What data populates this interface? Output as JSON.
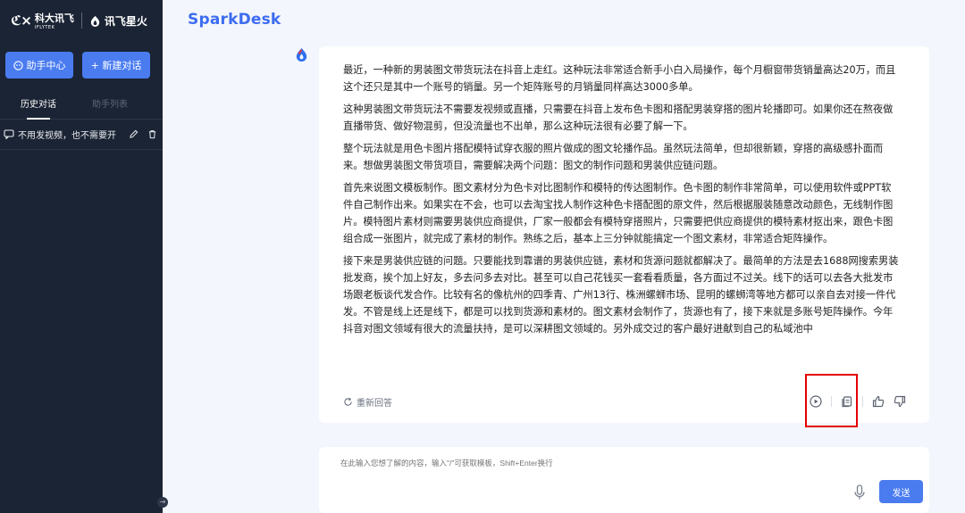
{
  "sidebar": {
    "logo_iflytek": "科大讯飞",
    "logo_iflytek_sub": "IFLYTEK",
    "logo_spark": "讯飞星火",
    "help_button": "助手中心",
    "new_chat_button": "+ 新建对话",
    "tabs": [
      "历史对话",
      "助手列表"
    ],
    "conversations": [
      {
        "title": "不用发视频，也不需要开"
      }
    ]
  },
  "header": {
    "brand": "SparkDesk"
  },
  "message": {
    "paragraphs": [
      "最近，一种新的男装图文带货玩法在抖音上走红。这种玩法非常适合新手小白入局操作，每个月橱窗带货销量高达20万，而且这个还只是其中一个账号的销量。另一个矩阵账号的月销量同样高达3000多单。",
      "这种男装图文带货玩法不需要发视频或直播，只需要在抖音上发布色卡图和搭配男装穿搭的图片轮播即可。如果你还在熬夜做直播带货、做好物混剪，但没流量也不出单，那么这种玩法很有必要了解一下。",
      "整个玩法就是用色卡图片搭配模特试穿衣服的照片做成的图文轮播作品。虽然玩法简单，但却很新颖，穿搭的高级感扑面而来。想做男装图文带货项目，需要解决两个问题：图文的制作问题和男装供应链问题。",
      "首先来说图文模板制作。图文素材分为色卡对比图制作和模特的传达图制作。色卡图的制作非常简单，可以使用软件或PPT软件自己制作出来。如果实在不会，也可以去淘宝找人制作这种色卡搭配图的原文件，然后根据服装随意改动颜色，无线制作图片。模特图片素材则需要男装供应商提供，厂家一般都会有模特穿搭照片，只需要把供应商提供的模特素材抠出来，跟色卡图组合成一张图片，就完成了素材的制作。熟练之后，基本上三分钟就能搞定一个图文素材，非常适合矩阵操作。",
      "接下来是男装供应链的问题。只要能找到靠谱的男装供应链，素材和货源问题就都解决了。最简单的方法是去1688网搜索男装批发商，挨个加上好友，多去问多去对比。甚至可以自己花钱买一套看看质量，各方面过不过关。线下的话可以去各大批发市场跟老板谈代发合作。比较有名的像杭州的四季青、广州13行、株洲螺蛳市场、昆明的螺蛳湾等地方都可以亲自去对接一件代发。不管是线上还是线下，都是可以找到货源和素材的。图文素材会制作了，货源也有了，接下来就是多账号矩阵操作。今年抖音对图文领域有很大的流量扶持，是可以深耕图文领域的。另外成交过的客户最好进献到自己的私域池中"
    ],
    "regenerate_label": "重新回答"
  },
  "input": {
    "placeholder": "在此输入您想了解的内容，输入\"/\"可获取模板，Shift+Enter换行",
    "send_label": "发送"
  },
  "colors": {
    "accent": "#4a7cf0",
    "sidebar_bg": "#1b2434",
    "highlight": "#e40000"
  }
}
